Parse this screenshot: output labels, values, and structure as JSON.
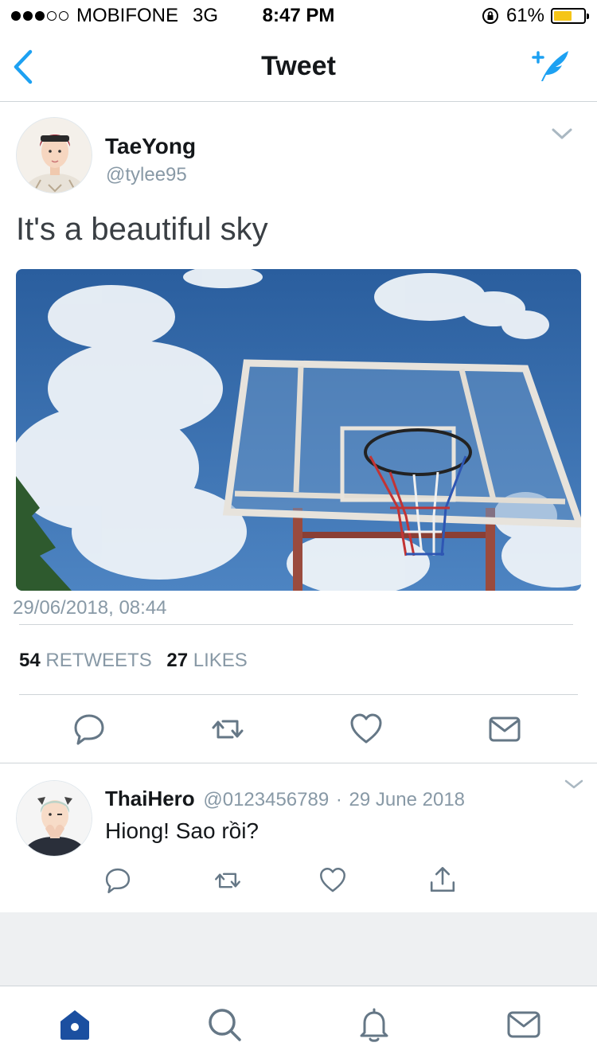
{
  "status_bar": {
    "carrier": "MOBIFONE",
    "network": "3G",
    "time": "8:47 PM",
    "battery": "61%",
    "battery_level": 0.61,
    "colors": {
      "battery_fill": "#f5c518"
    }
  },
  "nav": {
    "title": "Tweet",
    "icons": {
      "back": "chevron-left-icon",
      "compose": "compose-tweet-icon"
    }
  },
  "tweet": {
    "author_name": "TaeYong",
    "author_handle": "@tylee95",
    "text": "It's a beautiful sky",
    "timestamp": "29/06/2018, 08:44",
    "retweet_count": "54",
    "retweet_label": "RETWEETS",
    "like_count": "27",
    "like_label": "LIKES",
    "actions": [
      "reply-icon",
      "retweet-icon",
      "like-icon",
      "message-icon"
    ]
  },
  "reply": {
    "author_name": "ThaiHero",
    "author_handle": "@0123456789",
    "separator": "·",
    "date": "29 June 2018",
    "text": "Hiong! Sao rồi?",
    "actions": [
      "reply-icon",
      "retweet-icon",
      "like-icon",
      "share-icon"
    ]
  },
  "tab_bar": {
    "items": [
      "home-icon",
      "search-icon",
      "notifications-icon",
      "messages-icon"
    ],
    "active": "home-icon"
  },
  "colors": {
    "accent": "#1da1f2",
    "icon_gray": "#657786",
    "secondary_text": "#8899a6",
    "tab_active": "#1b4fa0"
  }
}
